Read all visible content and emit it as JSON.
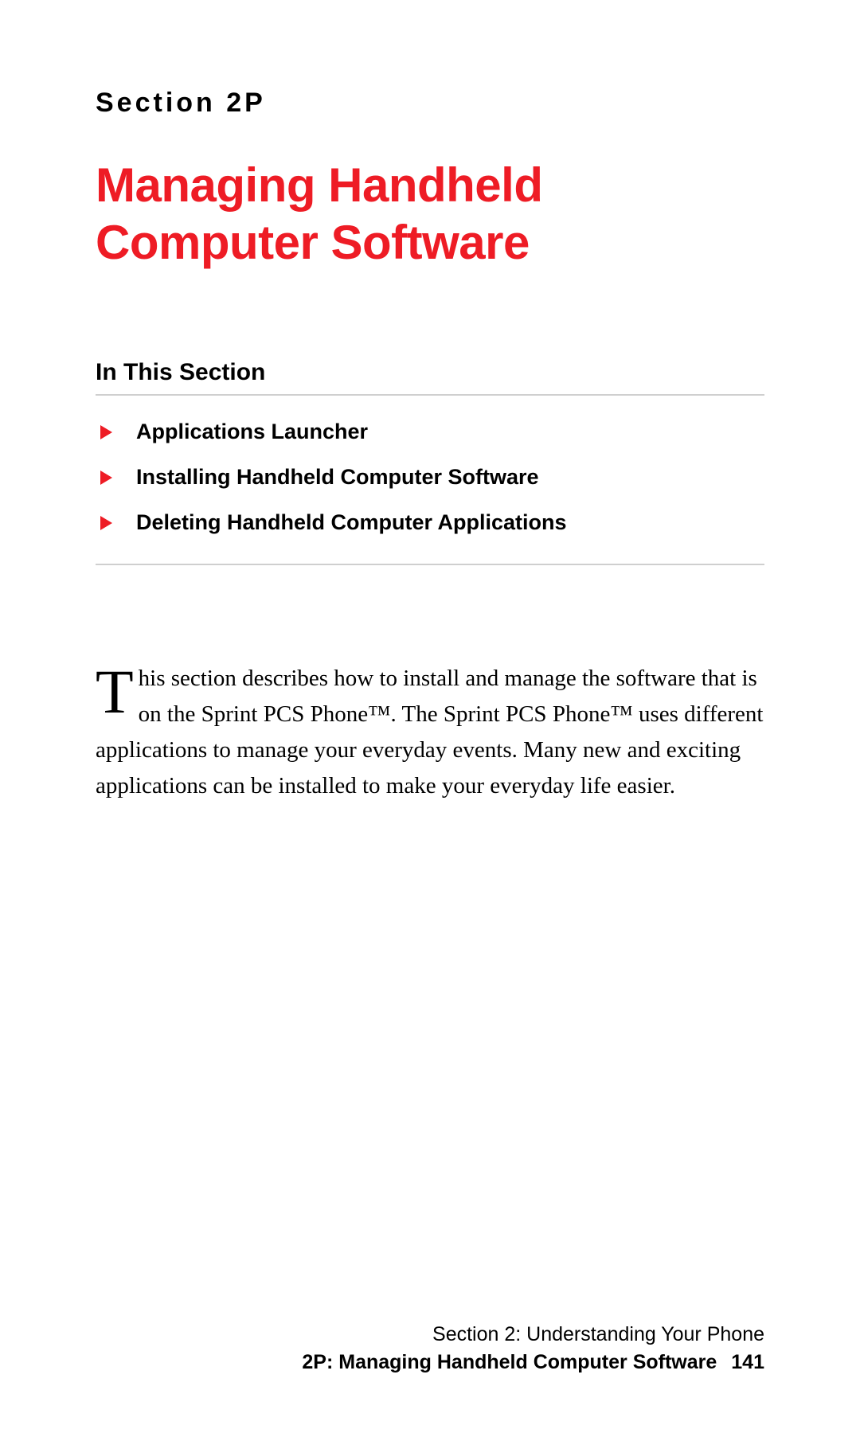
{
  "header": {
    "section_label": "Section 2P",
    "title": "Managing Handheld Computer Software"
  },
  "toc": {
    "heading": "In This Section",
    "items": [
      "Applications Launcher",
      "Installing Handheld Computer Software",
      "Deleting Handheld Computer Applications"
    ]
  },
  "body": {
    "dropcap": "T",
    "paragraph_rest": "his section describes how to install and manage the software that is on the Sprint PCS Phone™. The Sprint PCS Phone™ uses different applications to manage your everyday events. Many new and exciting applications can be installed to make your everyday life easier."
  },
  "footer": {
    "line1": "Section 2: Understanding Your Phone",
    "line2": "2P: Managing Handheld Computer Software",
    "page": "141"
  },
  "colors": {
    "accent_red": "#ee1c25",
    "rule_gray": "#cfcfcf"
  }
}
